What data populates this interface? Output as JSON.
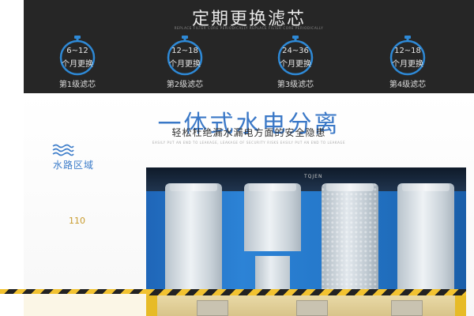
{
  "header": {
    "title": "定期更换滤芯",
    "caption": "REPLACE FILTER CORE PERIODICALLY REPLACE FILTER CORE PERIODICALLY"
  },
  "filters": [
    {
      "range": "6~12",
      "unit": "个月更换",
      "stage": "第1级滤芯"
    },
    {
      "range": "12~18",
      "unit": "个月更换",
      "stage": "第2级滤芯"
    },
    {
      "range": "24~36",
      "unit": "个月更换",
      "stage": "第3级滤芯"
    },
    {
      "range": "12~18",
      "unit": "个月更换",
      "stage": "第4级滤芯"
    }
  ],
  "section": {
    "headline": "一体式水电分离",
    "tagline": "轻松杜绝漏水漏电方面的安全隐患",
    "tiny_line": "EASILY PUT AN END TO LEAKAGE, LEAKAGE OF SECURITY RISKS EASILY PUT AN END TO LEAKAGE",
    "water_label": "水路区域",
    "partial_label": "110"
  },
  "product": {
    "brand": "TQJEN"
  },
  "colors": {
    "dark_band": "#262626",
    "accent_blue": "#3a78c7",
    "timer_blue": "#2e89d6",
    "hazard_yellow": "#f2c230"
  },
  "icons": [
    "stopwatch-icon",
    "water-waves-icon"
  ]
}
